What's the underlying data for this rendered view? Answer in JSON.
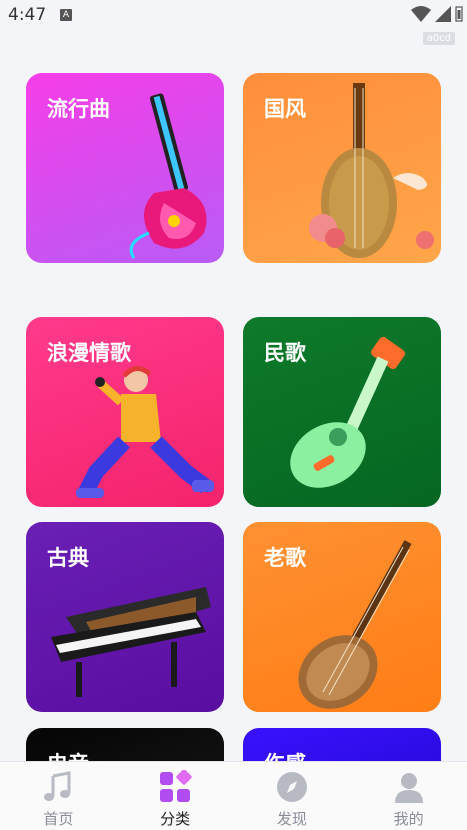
{
  "status_bar": {
    "time": "4:47",
    "a_badge": "A",
    "tag": "a0cd"
  },
  "categories": [
    {
      "label": "流行曲",
      "gradient": [
        "#f63de9",
        "#b85cf6"
      ]
    },
    {
      "label": "国风",
      "gradient": [
        "#ff8e3a",
        "#ffa64a"
      ]
    },
    {
      "label": "浪漫情歌",
      "gradient": [
        "#ff3a8c",
        "#f5236c"
      ]
    },
    {
      "label": "民歌",
      "gradient": [
        "#0e7a2a",
        "#056622"
      ]
    },
    {
      "label": "古典",
      "gradient": [
        "#6a1fb5",
        "#5a0ea0"
      ]
    },
    {
      "label": "老歌",
      "gradient": [
        "#ff9133",
        "#ff7d15"
      ]
    },
    {
      "label": "电音",
      "gradient": [
        "#050505",
        "#111111"
      ]
    },
    {
      "label": "伤感",
      "gradient": [
        "#3a12ff",
        "#2a0ae0"
      ]
    }
  ],
  "bottom_nav": [
    {
      "label": "首页",
      "icon": "music-note-icon"
    },
    {
      "label": "分类",
      "icon": "category-grid-icon"
    },
    {
      "label": "发现",
      "icon": "compass-icon"
    },
    {
      "label": "我的",
      "icon": "profile-icon"
    }
  ],
  "active_tab": "分类"
}
